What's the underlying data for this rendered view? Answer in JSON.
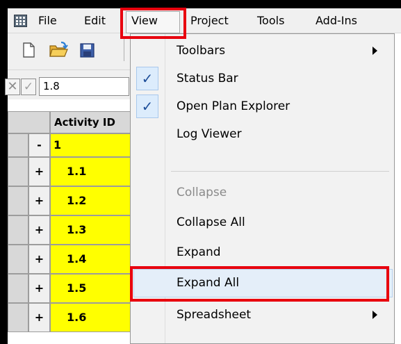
{
  "menubar": {
    "items": [
      {
        "label": "File"
      },
      {
        "label": "Edit"
      },
      {
        "label": "View"
      },
      {
        "label": "Project"
      },
      {
        "label": "Tools"
      },
      {
        "label": "Add-Ins"
      }
    ]
  },
  "toolbar": {
    "buttons": [
      "new-document-icon",
      "open-folder-icon",
      "save-icon"
    ]
  },
  "formula_bar": {
    "cancel_glyph": "✕",
    "confirm_glyph": "✓",
    "value": "1.8"
  },
  "grid": {
    "column_header": "Activity ID",
    "rows": [
      {
        "expander": "-",
        "id": "1"
      },
      {
        "expander": "+",
        "id": "1.1"
      },
      {
        "expander": "+",
        "id": "1.2"
      },
      {
        "expander": "+",
        "id": "1.3"
      },
      {
        "expander": "+",
        "id": "1.4"
      },
      {
        "expander": "+",
        "id": "1.5"
      },
      {
        "expander": "+",
        "id": "1.6"
      }
    ]
  },
  "view_menu": {
    "items": [
      {
        "label": "Toolbars",
        "submenu": true
      },
      {
        "label": "Status Bar",
        "checked": true
      },
      {
        "label": "Open Plan Explorer",
        "checked": true
      },
      {
        "label": "Log Viewer"
      },
      {
        "label": "Collapse",
        "disabled": true
      },
      {
        "label": "Collapse All"
      },
      {
        "label": "Expand"
      },
      {
        "label": "Expand All",
        "highlighted": true
      },
      {
        "label": "Spreadsheet",
        "submenu": true
      }
    ],
    "check_glyph": "✓"
  },
  "colors": {
    "highlight_red": "#e8000e",
    "row_yellow": "#ffff00",
    "menu_bg": "#f2f2f2",
    "check_blue": "#1e4f9a"
  }
}
